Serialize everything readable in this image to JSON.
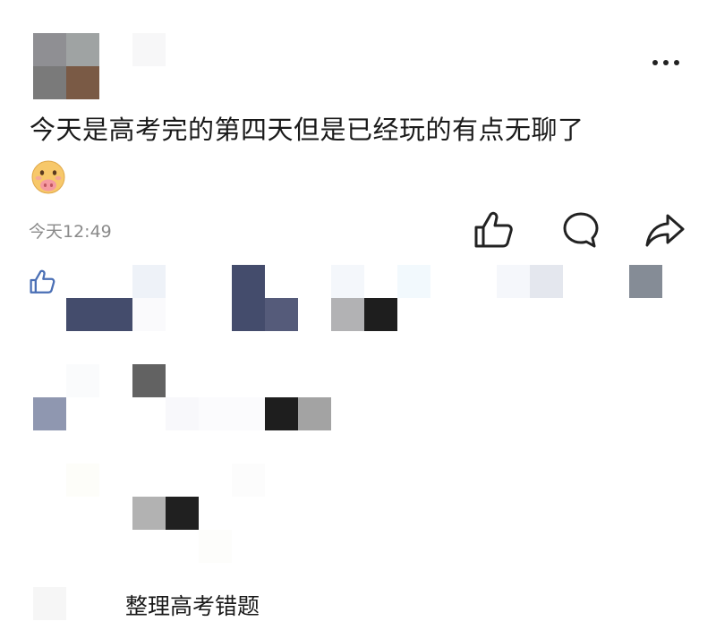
{
  "post": {
    "text": "今天是高考完的第四天但是已经玩的有点无聊了",
    "emoji": "pig-face-emoji",
    "timestamp": "今天12:49"
  },
  "actions": {
    "more": "more-options-icon",
    "like": "thumbs-up-icon",
    "comment": "comment-bubble-icon",
    "share": "share-arrow-icon"
  },
  "likes": {
    "icon": "thumbs-up-icon"
  },
  "comments": {
    "visible_text": "整理高考错题"
  },
  "colors": {
    "text": "#1a1a1a",
    "muted": "#8a8a8a",
    "icon_stroke": "#222222",
    "likes_icon": "#4a6fb5"
  }
}
